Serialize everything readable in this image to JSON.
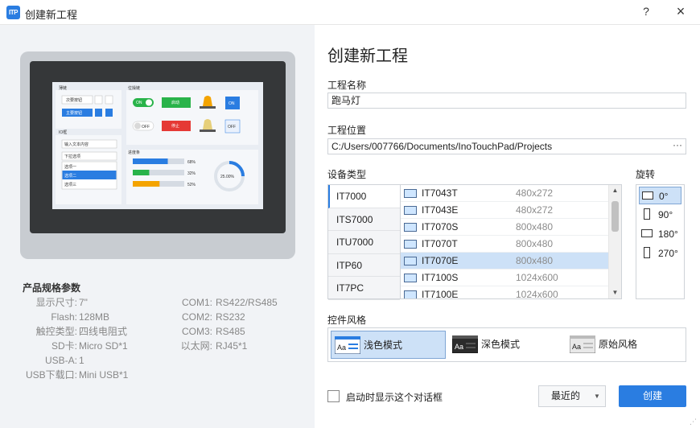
{
  "window": {
    "app_icon_text": "ITP",
    "title": "创建新工程",
    "help": "?",
    "close": "×"
  },
  "preview": {
    "screen": {
      "section_button": "薄链",
      "section_indicator": "位操链",
      "btn_secondary": "次要按钮",
      "btn_primary": "主要按钮",
      "toggle_on": "ON",
      "toggle_off": "OFF",
      "btn_start": "启动",
      "btn_stop": "停止",
      "btn_on": "ON",
      "btn_off": "OFF",
      "section_io": "IO框",
      "input_placeholder": "输入文本内容",
      "dropdown": "下拉选项",
      "options": [
        "选项一",
        "选项二",
        "选项三"
      ],
      "section_progress": "进度条",
      "progress": [
        {
          "label": "68%",
          "value": 0.68
        },
        {
          "label": "32%",
          "value": 0.32
        },
        {
          "label": "52%",
          "value": 0.52
        }
      ],
      "gauge_label": "25.00%",
      "gauge_value": 0.25
    }
  },
  "specs": {
    "title": "产品规格参数",
    "left": [
      {
        "label": "显示尺寸:",
        "value": "7\""
      },
      {
        "label": "Flash:",
        "value": "128MB"
      },
      {
        "label": "触控类型:",
        "value": "四线电阻式"
      },
      {
        "label": "SD卡:",
        "value": "Micro SD*1"
      },
      {
        "label": "USB-A:",
        "value": "1"
      },
      {
        "label": "USB下载口:",
        "value": "Mini USB*1"
      }
    ],
    "right": [
      {
        "label": "COM1:",
        "value": "RS422/RS485"
      },
      {
        "label": "COM2:",
        "value": "RS232"
      },
      {
        "label": "COM3:",
        "value": "RS485"
      },
      {
        "label": "以太网:",
        "value": "RJ45*1"
      }
    ]
  },
  "form": {
    "heading": "创建新工程",
    "name_label": "工程名称",
    "name_value": "跑马灯",
    "location_label": "工程位置",
    "location_value": "C:/Users/007766/Documents/InoTouchPad/Projects",
    "browse": "···",
    "device_type_label": "设备类型",
    "rotation_label": "旋转",
    "style_label": "控件风格",
    "show_on_start_label": "启动时显示这个对话框",
    "recent_button": "最近的",
    "create_button": "创建"
  },
  "device_types": [
    {
      "label": "IT7000",
      "selected": true
    },
    {
      "label": "ITS7000",
      "selected": false
    },
    {
      "label": "ITU7000",
      "selected": false
    },
    {
      "label": "ITP60",
      "selected": false
    },
    {
      "label": "IT7PC",
      "selected": false
    }
  ],
  "models": [
    {
      "name": "IT7043T",
      "resolution": "480x272",
      "selected": false
    },
    {
      "name": "IT7043E",
      "resolution": "480x272",
      "selected": false
    },
    {
      "name": "IT7070S",
      "resolution": "800x480",
      "selected": false
    },
    {
      "name": "IT7070T",
      "resolution": "800x480",
      "selected": false
    },
    {
      "name": "IT7070E",
      "resolution": "800x480",
      "selected": true
    },
    {
      "name": "IT7100S",
      "resolution": "1024x600",
      "selected": false
    },
    {
      "name": "IT7100E",
      "resolution": "1024x600",
      "selected": false
    }
  ],
  "rotations": [
    {
      "label": "0°",
      "selected": true
    },
    {
      "label": "90°",
      "selected": false
    },
    {
      "label": "180°",
      "selected": false
    },
    {
      "label": "270°",
      "selected": false
    }
  ],
  "styles": [
    {
      "label": "浅色模式",
      "icon": "light-theme-icon",
      "selected": true
    },
    {
      "label": "深色模式",
      "icon": "dark-theme-icon",
      "selected": false
    },
    {
      "label": "原始风格",
      "icon": "classic-theme-icon",
      "selected": false
    }
  ],
  "colors": {
    "accent": "#2a7de1",
    "selection": "#cde1f7"
  }
}
